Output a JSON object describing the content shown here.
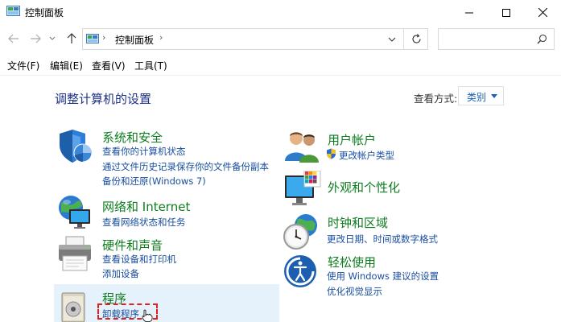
{
  "window": {
    "title": "控制面板"
  },
  "nav": {
    "address_path": "控制面板",
    "search_placeholder": ""
  },
  "menu": {
    "file": "文件(F)",
    "edit": "编辑(E)",
    "view": "查看(V)",
    "tools": "工具(T)"
  },
  "main": {
    "title": "调整计算机的设置",
    "view_by_label": "查看方式:",
    "view_by_value": "类别"
  },
  "categories_left": [
    {
      "title": "系统和安全",
      "links": [
        "查看你的计算机状态",
        "通过文件历史记录保存你的文件备份副本",
        "备份和还原(Windows 7)"
      ]
    },
    {
      "title": "网络和 Internet",
      "links": [
        "查看网络状态和任务"
      ]
    },
    {
      "title": "硬件和声音",
      "links": [
        "查看设备和打印机",
        "添加设备"
      ]
    },
    {
      "title": "程序",
      "links": [
        "卸载程序"
      ]
    }
  ],
  "categories_right": [
    {
      "title": "用户帐户",
      "links": [
        "更改帐户类型"
      ]
    },
    {
      "title": "外观和个性化",
      "links": []
    },
    {
      "title": "时钟和区域",
      "links": [
        "更改日期、时间或数字格式"
      ]
    },
    {
      "title": "轻松使用",
      "links": [
        "使用 Windows 建议的设置",
        "优化视觉显示"
      ]
    }
  ],
  "colors": {
    "category_title": "#0e7d1f",
    "link": "#1a4fa0",
    "page_title": "#1e3287",
    "highlight_bg": "#e5f1fb",
    "annotation": "#e02020"
  }
}
